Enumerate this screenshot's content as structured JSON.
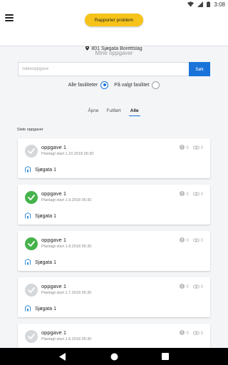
{
  "status_bar": {
    "time": "3:08"
  },
  "header": {
    "report_button": "Rapporter problem",
    "address": "801 Sjøgata Borettslag"
  },
  "page": {
    "title": "Mine oppgaver"
  },
  "search": {
    "placeholder": "Søkeoppgave",
    "button": "Søk"
  },
  "filter": {
    "options": [
      {
        "label": "Alle fasiliteter",
        "selected": true
      },
      {
        "label": "På valgt fasilitet",
        "selected": false
      }
    ]
  },
  "tabs": [
    {
      "label": "Åpne"
    },
    {
      "label": "Fullført"
    },
    {
      "label": "Alle",
      "active": true
    }
  ],
  "section": {
    "title": "Siste oppgaver"
  },
  "tasks": [
    {
      "title": "oppgave 1",
      "planned": "Planlagt start 1.10.2018 05:30",
      "location": "Sjøgata 1",
      "issues": "0",
      "links": "0",
      "completed": false
    },
    {
      "title": "oppgave 1",
      "planned": "Planlagt start 1.9.2018 05:30",
      "location": "Sjøgata 1",
      "issues": "0",
      "links": "0",
      "completed": true
    },
    {
      "title": "oppgave 1",
      "planned": "Planlagt start 1.8.2018 05:30",
      "location": "Sjøgata 1",
      "issues": "0",
      "links": "0",
      "completed": true
    },
    {
      "title": "oppgave 1",
      "planned": "Planlagt start 1.7.2018 05:30",
      "location": "Sjøgata 1",
      "issues": "0",
      "links": "0",
      "completed": false
    },
    {
      "title": "oppgave 1",
      "planned": "Planlagt start 1.6.2018 05:30",
      "location": "Sjøgata 1",
      "issues": "0",
      "links": "0",
      "completed": false
    }
  ],
  "colors": {
    "accent": "#1a73d8",
    "report_button": "#f6c31a",
    "done": "#45b34a",
    "todo": "#d5d8db"
  }
}
